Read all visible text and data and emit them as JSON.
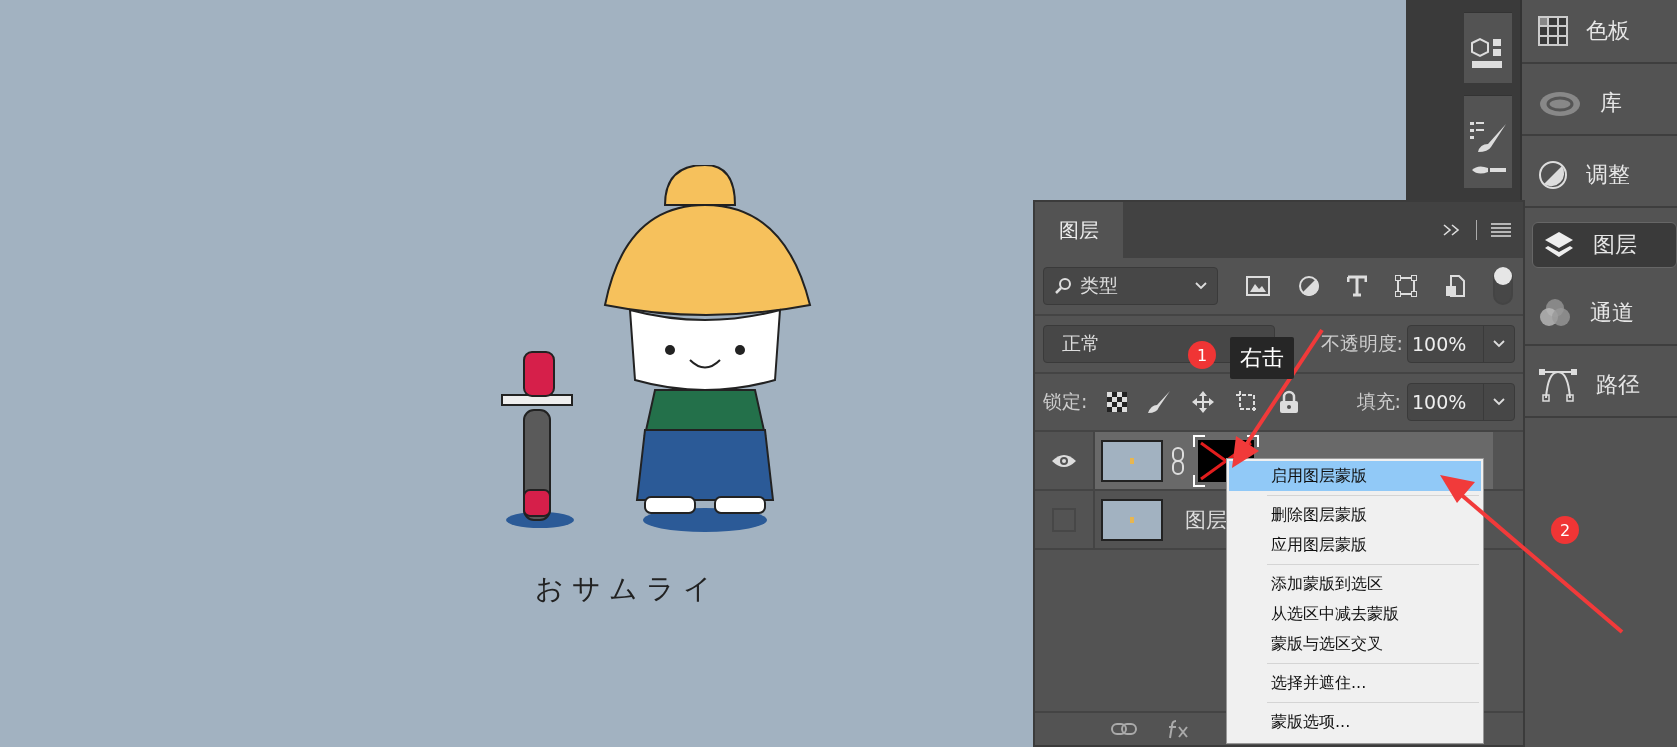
{
  "canvas": {
    "caption": "おサムライ"
  },
  "side_dock": {
    "items": [
      {
        "kind": "swatches",
        "label": "色板",
        "selected": false
      },
      {
        "kind": "libraries",
        "label": "库",
        "selected": false
      },
      {
        "kind": "adjustments",
        "label": "调整",
        "selected": false
      },
      {
        "kind": "layers",
        "label": "图层",
        "selected": true
      },
      {
        "kind": "channels",
        "label": "通道",
        "selected": false
      },
      {
        "kind": "paths",
        "label": "路径",
        "selected": false
      }
    ]
  },
  "layers_panel": {
    "tab": "图层",
    "filter": {
      "value": "类型"
    },
    "blend_mode": "正常",
    "opacity_label": "不透明度:",
    "opacity": "100%",
    "lock_label": "锁定:",
    "fill_label": "填充:",
    "fill": "100%",
    "layers": [
      {
        "visible": true,
        "selected": true,
        "has_mask": true
      },
      {
        "name": "图层",
        "visible": false,
        "selected": false,
        "has_mask": false
      }
    ]
  },
  "context_menu": {
    "groups": [
      [
        {
          "label": "启用图层蒙版",
          "selected": true
        }
      ],
      [
        {
          "label": "删除图层蒙版",
          "selected": false
        },
        {
          "label": "应用图层蒙版",
          "selected": false
        }
      ],
      [
        {
          "label": "添加蒙版到选区",
          "selected": false
        },
        {
          "label": "从选区中减去蒙版",
          "selected": false
        },
        {
          "label": "蒙版与选区交叉",
          "selected": false
        }
      ],
      [
        {
          "label": "选择并遮住...",
          "selected": false
        }
      ],
      [
        {
          "label": "蒙版选项...",
          "selected": false
        }
      ]
    ]
  },
  "annotations": {
    "step_1": "1",
    "tooltip": "右击",
    "step_2": "2"
  }
}
